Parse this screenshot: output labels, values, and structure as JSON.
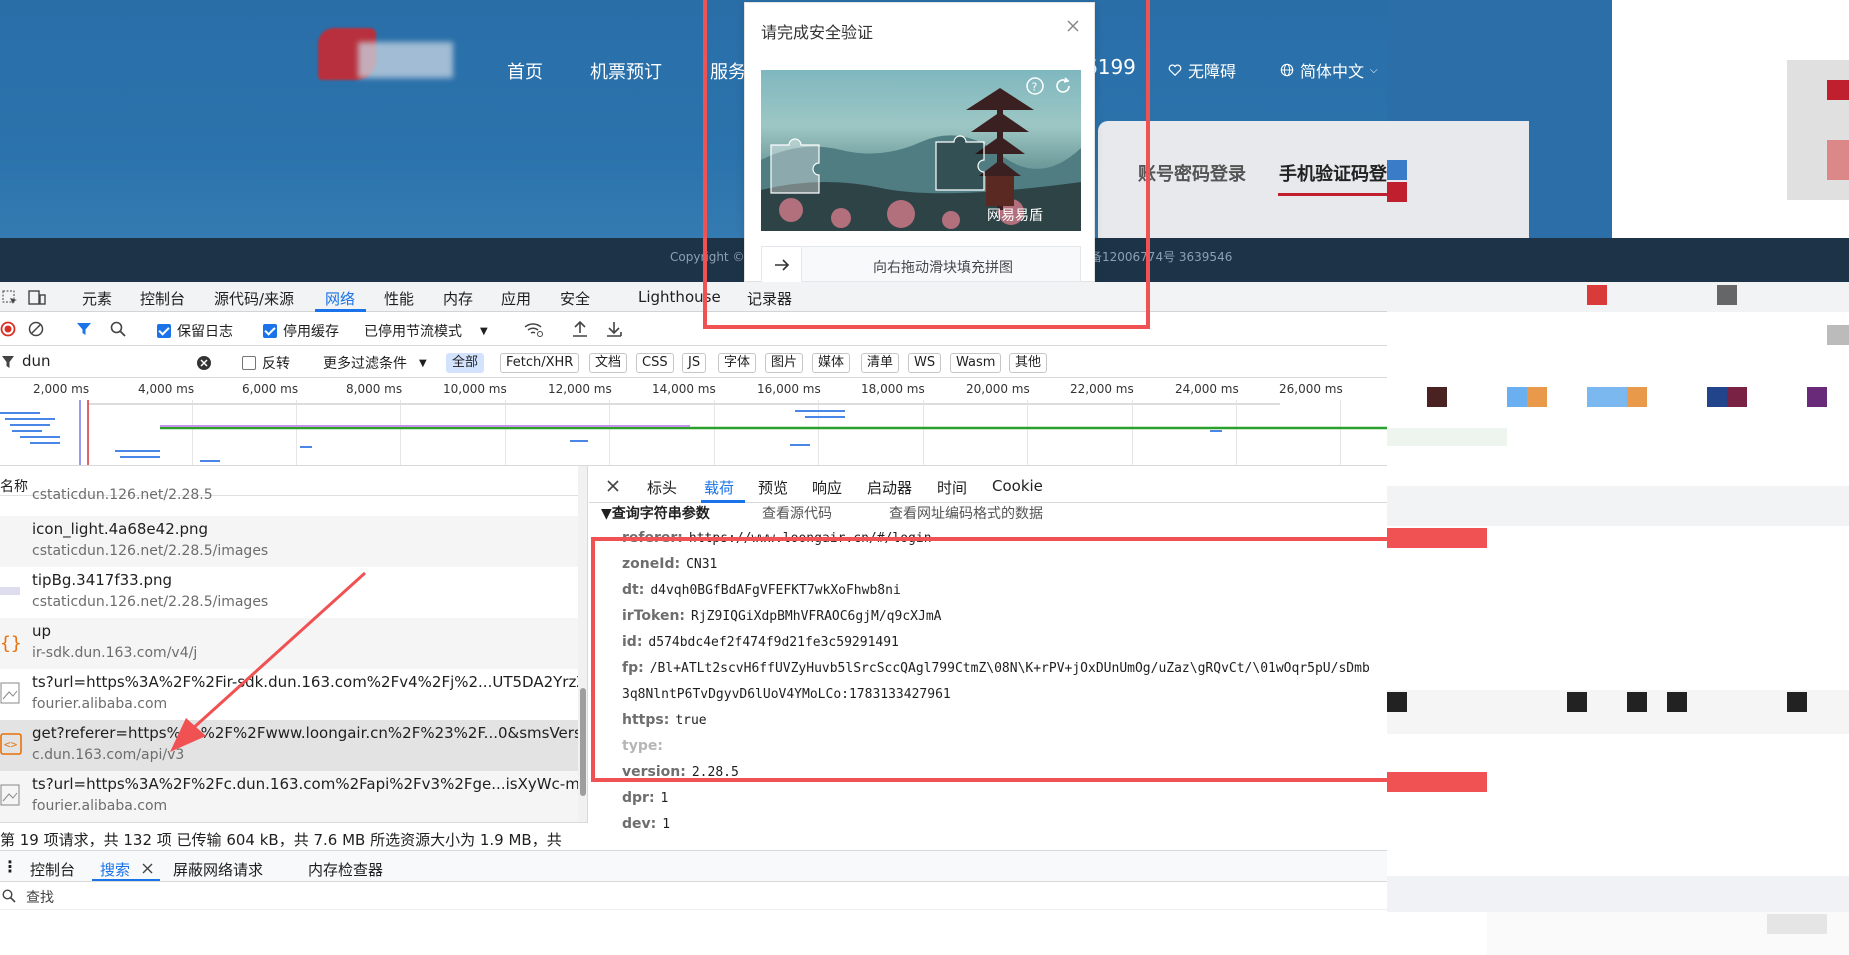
{
  "site": {
    "nav": [
      "首页",
      "机票预订",
      "服务"
    ],
    "phone_fragment": "6199",
    "accessibility": "无障碍",
    "language": "简体中文",
    "login_tabs": [
      "账号密码登录",
      "手机验证码登"
    ],
    "footer_left": "Copyright © 2",
    "footer_right": "备12006774号  3639546"
  },
  "captcha": {
    "title": "请完成安全验证",
    "watermark": "网易易盾",
    "slider_hint": "向右拖动滑块填充拼图",
    "icons": [
      "help-icon",
      "refresh-icon",
      "close-icon",
      "arrow-right-icon"
    ]
  },
  "devtools": {
    "main_tabs": [
      "元素",
      "控制台",
      "源代码/来源",
      "网络",
      "性能",
      "内存",
      "应用",
      "安全",
      "Lighthouse",
      "记录器"
    ],
    "active_main_tab": "网络",
    "toolbar": {
      "preserve_log": "保留日志",
      "disable_cache": "停用缓存",
      "throttle": "已停用节流模式"
    },
    "filter": {
      "value": "dun",
      "invert": "反转",
      "more_filters": "更多过滤条件",
      "types": [
        "全部",
        "Fetch/XHR",
        "文档",
        "CSS",
        "JS",
        "字体",
        "图片",
        "媒体",
        "清单",
        "WS",
        "Wasm",
        "其他"
      ]
    },
    "timeline_ticks": [
      "2,000 ms",
      "4,000 ms",
      "6,000 ms",
      "8,000 ms",
      "10,000 ms",
      "12,000 ms",
      "14,000 ms",
      "16,000 ms",
      "18,000 ms",
      "20,000 ms",
      "22,000 ms",
      "24,000 ms",
      "26,000 ms"
    ],
    "column_header": "名称",
    "requests": [
      {
        "name": "",
        "sub": "cstaticdun.126.net/2.28.5"
      },
      {
        "name": "icon_light.4a68e42.png",
        "sub": "cstaticdun.126.net/2.28.5/images"
      },
      {
        "name": "tipBg.3417f33.png",
        "sub": "cstaticdun.126.net/2.28.5/images"
      },
      {
        "name": "up",
        "sub": "ir-sdk.dun.163.com/v4/j"
      },
      {
        "name": "ts?url=https%3A%2F%2Fir-sdk.dun.163.com%2Fv4%2Fj%2...UT5DA2YrzZ...",
        "sub": "fourier.alibaba.com"
      },
      {
        "name": "get?referer=https%3A%2F%2Fwww.loongair.cn%2F%23%2F...0&smsVersi...",
        "sub": "c.dun.163.com/api/v3"
      },
      {
        "name": "ts?url=https%3A%2F%2Fc.dun.163.com%2Fapi%2Fv3%2Fge...isXyWc-m...",
        "sub": "fourier.alibaba.com"
      }
    ],
    "status": "第 19 项请求，共 132 项   已传输 604 kB，共 7.6 MB   所选资源大小为 1.9 MB，共",
    "detail_tabs": [
      "标头",
      "载荷",
      "预览",
      "响应",
      "启动器",
      "时间",
      "Cookie"
    ],
    "active_detail_tab": "载荷",
    "payload_section": "▼查询字符串参数",
    "payload_links": [
      "查看源代码",
      "查看网址编码格式的数据"
    ],
    "params": [
      {
        "k": "referer:",
        "v": "https://www.loongair.cn/#/login"
      },
      {
        "k": "zoneId:",
        "v": "CN31"
      },
      {
        "k": "dt:",
        "v": "d4vqh0BGfBdAFgVFEFKT7wkXoFhwb8ni"
      },
      {
        "k": "irToken:",
        "v": "RjZ9IQGiXdpBMhVFRAOC6gjM/q9cXJmA"
      },
      {
        "k": "id:",
        "v": "d574bdc4ef2f474f9d21fe3c59291491"
      },
      {
        "k": "fp:",
        "v": "/Bl+ATLt2scvH6ffUVZyHuvb5lSrcSccQAgl799CtmZ\\08N\\K+rPV+jOxDUnUmOg/uZaz\\gRQvCt/\\01wOqr5pU/sDmb"
      },
      {
        "k": "",
        "v": "3q8NlntP6TvDgyvD6lUoV4YMoLCo:1783133427961"
      },
      {
        "k": "https:",
        "v": "true"
      },
      {
        "k": "type:",
        "v": ""
      },
      {
        "k": "version:",
        "v": "2.28.5"
      },
      {
        "k": "dpr:",
        "v": "1"
      },
      {
        "k": "dev:",
        "v": "1"
      }
    ],
    "drawer_tabs": [
      "控制台",
      "搜索",
      "屏蔽网络请求",
      "内存检查器"
    ],
    "active_drawer_tab": "搜索",
    "search_placeholder": "查找"
  },
  "colors": {
    "annotation_red": "#f05254",
    "devtools_blue": "#1a73e8",
    "site_blue": "#2a6ea8"
  }
}
